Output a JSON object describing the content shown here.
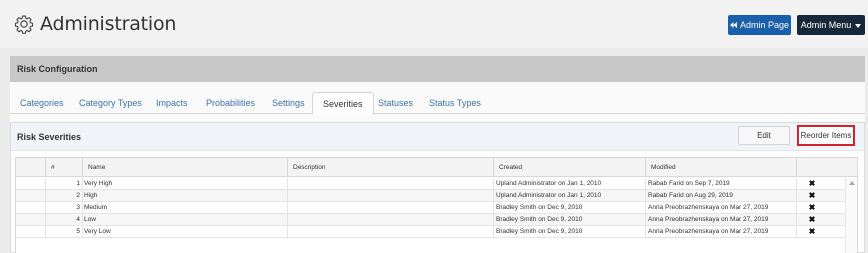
{
  "header": {
    "title": "Administration",
    "admin_page_label": "Admin Page",
    "admin_menu_label": "Admin Menu"
  },
  "section": {
    "title": "Risk Configuration"
  },
  "tabs": [
    {
      "label": "Categories",
      "active": false
    },
    {
      "label": "Category Types",
      "active": false
    },
    {
      "label": "Impacts",
      "active": false
    },
    {
      "label": "Probabilities",
      "active": false
    },
    {
      "label": "Settings",
      "active": false
    },
    {
      "label": "Severities",
      "active": true
    },
    {
      "label": "Statuses",
      "active": false
    },
    {
      "label": "Status Types",
      "active": false
    }
  ],
  "panel": {
    "title": "Risk Severities",
    "edit_label": "Edit",
    "reorder_label": "Reorder Items"
  },
  "table": {
    "columns": [
      "#",
      "Name",
      "Description",
      "Created",
      "Modified"
    ],
    "rows": [
      {
        "num": "1",
        "name": "Very High",
        "description": "",
        "created": "Upland Administrator on Jan 1, 2010",
        "modified": "Rabab Farid on Sep 7, 2019",
        "delete_icon": "✖"
      },
      {
        "num": "2",
        "name": "High",
        "description": "",
        "created": "Upland Administrator on Jan 1, 2010",
        "modified": "Rabab Farid on Aug 29, 2019",
        "delete_icon": "✖"
      },
      {
        "num": "3",
        "name": "Medium",
        "description": "",
        "created": "Bradley Smith on Dec 9, 2010",
        "modified": "Anna Preobrazhenskaya on Mar 27, 2019",
        "delete_icon": "✖"
      },
      {
        "num": "4",
        "name": "Low",
        "description": "",
        "created": "Bradley Smith on Dec 9, 2010",
        "modified": "Anna Preobrazhenskaya on Mar 27, 2019",
        "delete_icon": "✖"
      },
      {
        "num": "5",
        "name": "Very Low",
        "description": "",
        "created": "Bradley Smith on Dec 9, 2010",
        "modified": "Anna Preobrazhenskaya on Mar 27, 2019",
        "delete_icon": "✖"
      }
    ]
  },
  "colors": {
    "primary_button": "#1a5faa",
    "dark_button": "#16283a",
    "tab_link": "#3a74b6",
    "highlight_border": "#d3222a"
  }
}
